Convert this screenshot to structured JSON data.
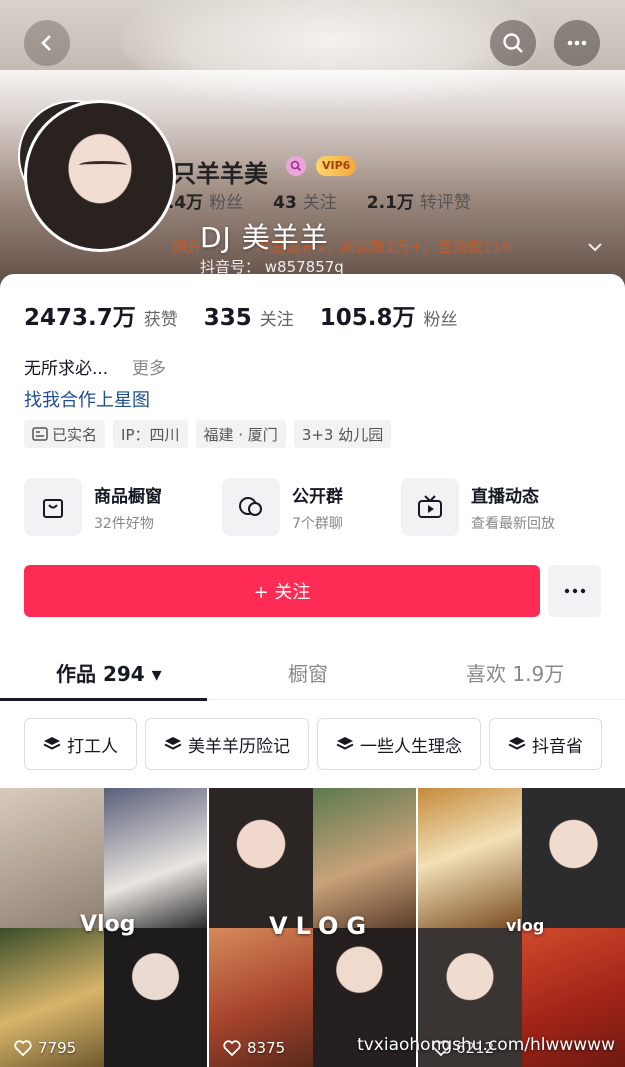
{
  "header": {
    "back_icon": "chevron-left-icon",
    "search_icon": "search-icon",
    "more_icon": "ellipsis-icon"
  },
  "ghost": {
    "name": "一只羊羊美",
    "vip": "VIP6",
    "stats": [
      {
        "num": "2.4万",
        "label": "粉丝"
      },
      {
        "num": "43",
        "label": "关注"
      },
      {
        "num": "2.1万",
        "label": "转评赞"
      }
    ],
    "dj_name": "DJ 美羊羊",
    "status_left": "飙升",
    "status_right": "昨日发布1，阅读数1万+，互动数116",
    "douyin_id": "抖音号： w857857q"
  },
  "profile": {
    "stats": [
      {
        "num": "2473.7万",
        "label": "获赞"
      },
      {
        "num": "335",
        "label": "关注"
      },
      {
        "num": "105.8万",
        "label": "粉丝"
      }
    ],
    "bio": "无所求必...",
    "bio_more": "更多",
    "collab_link": "找我合作上星图",
    "tags": [
      "已实名",
      "IP：四川",
      "福建 · 厦门",
      "3+3 幼儿园"
    ]
  },
  "features": [
    {
      "title": "商品橱窗",
      "sub": "32件好物",
      "icon": "shopping-bag-icon"
    },
    {
      "title": "公开群",
      "sub": "7个群聊",
      "icon": "chat-group-icon"
    },
    {
      "title": "直播动态",
      "sub": "查看最新回放",
      "icon": "tv-play-icon"
    }
  ],
  "actions": {
    "follow": "+ 关注"
  },
  "tabs": [
    {
      "label": "作品 294 ▾"
    },
    {
      "label": "橱窗"
    },
    {
      "label": "喜欢 1.9万"
    }
  ],
  "collections": [
    "打工人",
    "美羊羊历险记",
    "一些人生理念",
    "抖音省"
  ],
  "grid": [
    {
      "label": "Vlog",
      "likes": "7795"
    },
    {
      "label": "VLOG",
      "likes": "8375"
    },
    {
      "label": "vlog",
      "likes": "6212"
    }
  ],
  "watermark": "tvxiaohongshu.com/hlwwwww"
}
